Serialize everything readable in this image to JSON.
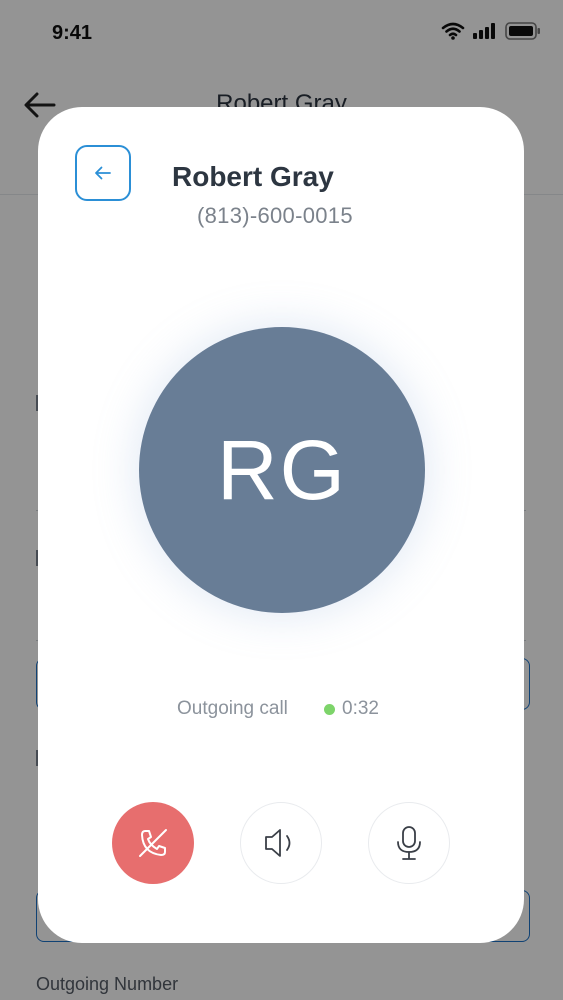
{
  "status_bar": {
    "time": "9:41"
  },
  "background": {
    "header_title": "Robert Gray",
    "outgoing_number_label": "Outgoing Number"
  },
  "call": {
    "contact_name": "Robert Gray",
    "phone": "(813)-600-0015",
    "initials": "RG",
    "status": "Outgoing call",
    "timer": "0:32"
  },
  "icons": {
    "back": "arrow-left-icon",
    "end_call": "phone-hangup-icon",
    "speaker": "speaker-icon",
    "mute": "microphone-icon"
  },
  "colors": {
    "accent": "#2b8fd6",
    "avatar": "#687d96",
    "end_call": "#e76e6e",
    "timer_dot": "#7dd46a"
  }
}
